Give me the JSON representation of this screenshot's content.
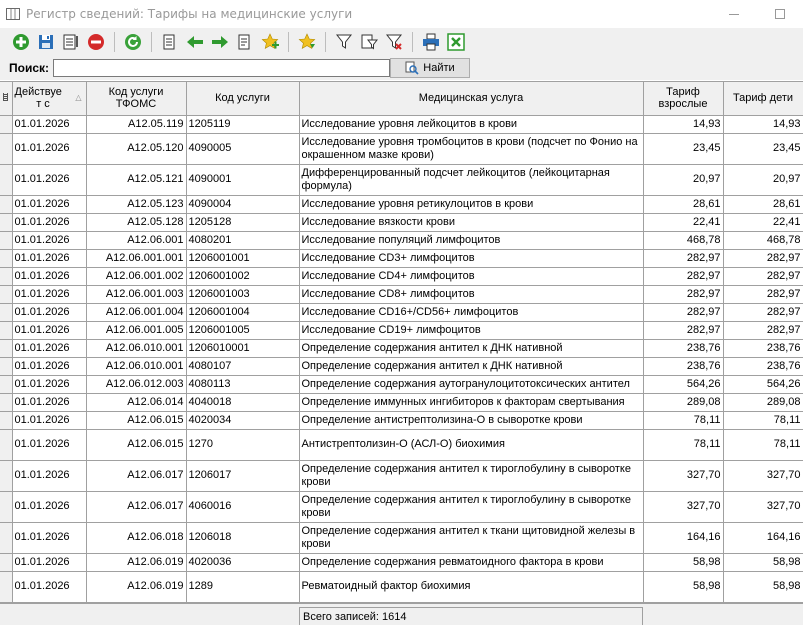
{
  "window": {
    "title": "Регистр сведений: Тарифы на медицинские услуги"
  },
  "search": {
    "label": "Поиск:",
    "value": "",
    "button_label": "Найти"
  },
  "table": {
    "headers": {
      "date": [
        "Действуе",
        "т с"
      ],
      "tfoms": [
        "Код услуги",
        "ТФОМС"
      ],
      "code": "Код услуги",
      "service": "Медицинская услуга",
      "adult": [
        "Тариф",
        "взрослые"
      ],
      "child": "Тариф дети"
    },
    "rows": [
      {
        "date": "01.01.2026",
        "tfoms": "A12.05.119",
        "code": "1205119",
        "name": "Исследование уровня лейкоцитов в крови",
        "adult": "14,93",
        "child": "14,93"
      },
      {
        "date": "01.01.2026",
        "tfoms": "A12.05.120",
        "code": "4090005",
        "name": "Исследование уровня тромбоцитов в крови (подсчет по Фонио на окрашенном мазке крови)",
        "adult": "23,45",
        "child": "23,45"
      },
      {
        "date": "01.01.2026",
        "tfoms": "A12.05.121",
        "code": "4090001",
        "name": "Дифференцированный подсчет лейкоцитов (лейкоцитарная формула)",
        "adult": "20,97",
        "child": "20,97"
      },
      {
        "date": "01.01.2026",
        "tfoms": "A12.05.123",
        "code": "4090004",
        "name": "Исследование уровня ретикулоцитов в крови",
        "adult": "28,61",
        "child": "28,61"
      },
      {
        "date": "01.01.2026",
        "tfoms": "A12.05.128",
        "code": "1205128",
        "name": "Исследование вязкости крови",
        "adult": "22,41",
        "child": "22,41"
      },
      {
        "date": "01.01.2026",
        "tfoms": "A12.06.001",
        "code": "4080201",
        "name": "Исследование популяций лимфоцитов",
        "adult": "468,78",
        "child": "468,78"
      },
      {
        "date": "01.01.2026",
        "tfoms": "A12.06.001.001",
        "code": "1206001001",
        "name": "Исследование CD3+ лимфоцитов",
        "adult": "282,97",
        "child": "282,97"
      },
      {
        "date": "01.01.2026",
        "tfoms": "A12.06.001.002",
        "code": "1206001002",
        "name": "Исследование CD4+ лимфоцитов",
        "adult": "282,97",
        "child": "282,97"
      },
      {
        "date": "01.01.2026",
        "tfoms": "A12.06.001.003",
        "code": "1206001003",
        "name": "Исследование CD8+ лимфоцитов",
        "adult": "282,97",
        "child": "282,97"
      },
      {
        "date": "01.01.2026",
        "tfoms": "A12.06.001.004",
        "code": "1206001004",
        "name": "Исследование CD16+/CD56+ лимфоцитов",
        "adult": "282,97",
        "child": "282,97"
      },
      {
        "date": "01.01.2026",
        "tfoms": "A12.06.001.005",
        "code": "1206001005",
        "name": "Исследование CD19+ лимфоцитов",
        "adult": "282,97",
        "child": "282,97"
      },
      {
        "date": "01.01.2026",
        "tfoms": "A12.06.010.001",
        "code": "1206010001",
        "name": "Определение содержания антител к ДНК нативной",
        "adult": "238,76",
        "child": "238,76"
      },
      {
        "date": "01.01.2026",
        "tfoms": "A12.06.010.001",
        "code": "4080107",
        "name": "Определение содержания антител к ДНК нативной",
        "adult": "238,76",
        "child": "238,76"
      },
      {
        "date": "01.01.2026",
        "tfoms": "A12.06.012.003",
        "code": "4080113",
        "name": "Определение содержания аутогранулоцитотоксических антител",
        "adult": "564,26",
        "child": "564,26"
      },
      {
        "date": "01.01.2026",
        "tfoms": "A12.06.014",
        "code": "4040018",
        "name": "Определение иммунных ингибиторов к факторам свертывания",
        "adult": "289,08",
        "child": "289,08"
      },
      {
        "date": "01.01.2026",
        "tfoms": "A12.06.015",
        "code": "4020034",
        "name": "Определение антистрептолизина-О в сыворотке крови",
        "adult": "78,11",
        "child": "78,11"
      },
      {
        "date": "01.01.2026",
        "tfoms": "A12.06.015",
        "code": "1270",
        "name": "Антистрептолизин-О (АСЛ-О) биохимия",
        "adult": "78,11",
        "child": "78,11"
      },
      {
        "date": "01.01.2026",
        "tfoms": "A12.06.017",
        "code": "1206017",
        "name": "Определение содержания антител к тироглобулину в сыворотке крови",
        "adult": "327,70",
        "child": "327,70"
      },
      {
        "date": "01.01.2026",
        "tfoms": "A12.06.017",
        "code": "4060016",
        "name": "Определение содержания антител к тироглобулину в сыворотке крови",
        "adult": "327,70",
        "child": "327,70"
      },
      {
        "date": "01.01.2026",
        "tfoms": "A12.06.018",
        "code": "1206018",
        "name": "Определение содержания антител к ткани щитовидной железы в крови",
        "adult": "164,16",
        "child": "164,16"
      },
      {
        "date": "01.01.2026",
        "tfoms": "A12.06.019",
        "code": "4020036",
        "name": "Определение содержания ревматоидного фактора в крови",
        "adult": "58,98",
        "child": "58,98"
      },
      {
        "date": "01.01.2026",
        "tfoms": "A12.06.019",
        "code": "1289",
        "name": "Ревматоидный фактор биохимия",
        "adult": "58,98",
        "child": "58,98"
      }
    ]
  },
  "status": {
    "total_label": "Всего записей: 1614"
  }
}
